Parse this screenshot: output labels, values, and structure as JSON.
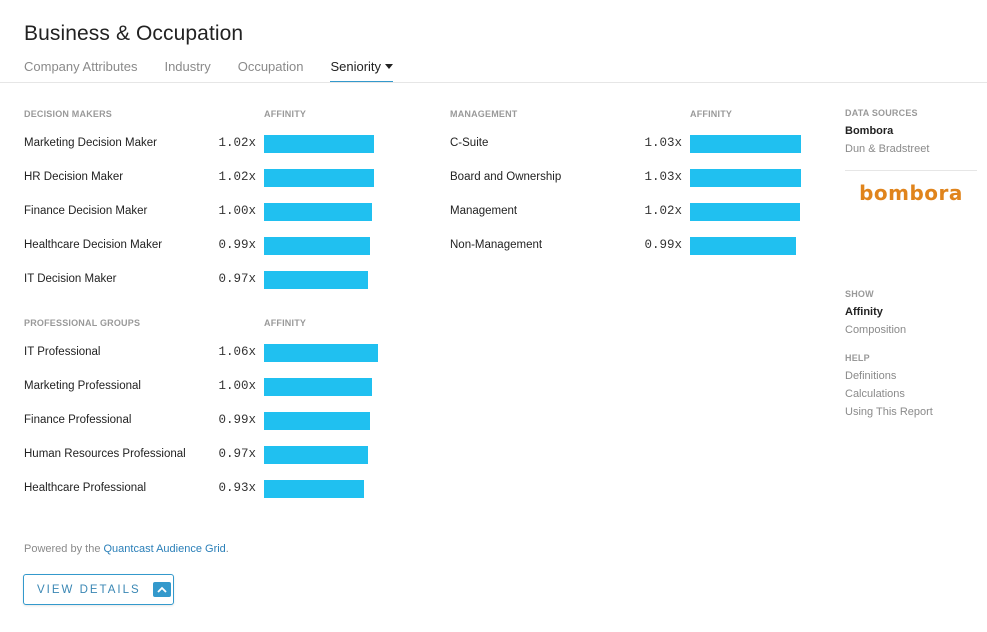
{
  "header": {
    "title": "Business & Occupation",
    "tabs": [
      {
        "label": "Company Attributes",
        "active": false
      },
      {
        "label": "Industry",
        "active": false
      },
      {
        "label": "Occupation",
        "active": false
      },
      {
        "label": "Seniority",
        "active": true,
        "dropdown": true
      }
    ]
  },
  "sections": {
    "decision_makers": {
      "title": "DECISION MAKERS",
      "metric": "AFFINITY",
      "rows": [
        {
          "label": "Marketing Decision Maker",
          "value_text": "1.02x",
          "value": 1.02
        },
        {
          "label": "HR Decision Maker",
          "value_text": "1.02x",
          "value": 1.02
        },
        {
          "label": "Finance Decision Maker",
          "value_text": "1.00x",
          "value": 1.0
        },
        {
          "label": "Healthcare Decision Maker",
          "value_text": "0.99x",
          "value": 0.99
        },
        {
          "label": "IT Decision Maker",
          "value_text": "0.97x",
          "value": 0.97
        }
      ]
    },
    "professional_groups": {
      "title": "PROFESSIONAL GROUPS",
      "metric": "AFFINITY",
      "rows": [
        {
          "label": "IT Professional",
          "value_text": "1.06x",
          "value": 1.06
        },
        {
          "label": "Marketing Professional",
          "value_text": "1.00x",
          "value": 1.0
        },
        {
          "label": "Finance Professional",
          "value_text": "0.99x",
          "value": 0.99
        },
        {
          "label": "Human Resources Professional",
          "value_text": "0.97x",
          "value": 0.97
        },
        {
          "label": "Healthcare Professional",
          "value_text": "0.93x",
          "value": 0.93
        }
      ]
    },
    "management": {
      "title": "MANAGEMENT",
      "metric": "AFFINITY",
      "rows": [
        {
          "label": "C-Suite",
          "value_text": "1.03x",
          "value": 1.03
        },
        {
          "label": "Board and Ownership",
          "value_text": "1.03x",
          "value": 1.03
        },
        {
          "label": "Management",
          "value_text": "1.02x",
          "value": 1.02
        },
        {
          "label": "Non-Management",
          "value_text": "0.99x",
          "value": 0.99
        }
      ]
    }
  },
  "sidebar": {
    "data_sources_title": "DATA SOURCES",
    "data_sources": [
      {
        "label": "Bombora",
        "active": true
      },
      {
        "label": "Dun & Bradstreet",
        "active": false
      }
    ],
    "logo_text": "bombora",
    "show_title": "SHOW",
    "show_options": [
      {
        "label": "Affinity",
        "active": true
      },
      {
        "label": "Composition",
        "active": false
      }
    ],
    "help_title": "HELP",
    "help_links": [
      "Definitions",
      "Calculations",
      "Using This Report"
    ]
  },
  "footer": {
    "powered_prefix": "Powered by the ",
    "powered_link": "Quantcast Audience Grid",
    "powered_suffix": ".",
    "view_details_label": "VIEW DETAILS",
    "view_details_icon": "chevron-up-icon"
  },
  "colors": {
    "bar": "#20c0f0",
    "accent": "#3399cc",
    "logo": "#e0841c"
  }
}
